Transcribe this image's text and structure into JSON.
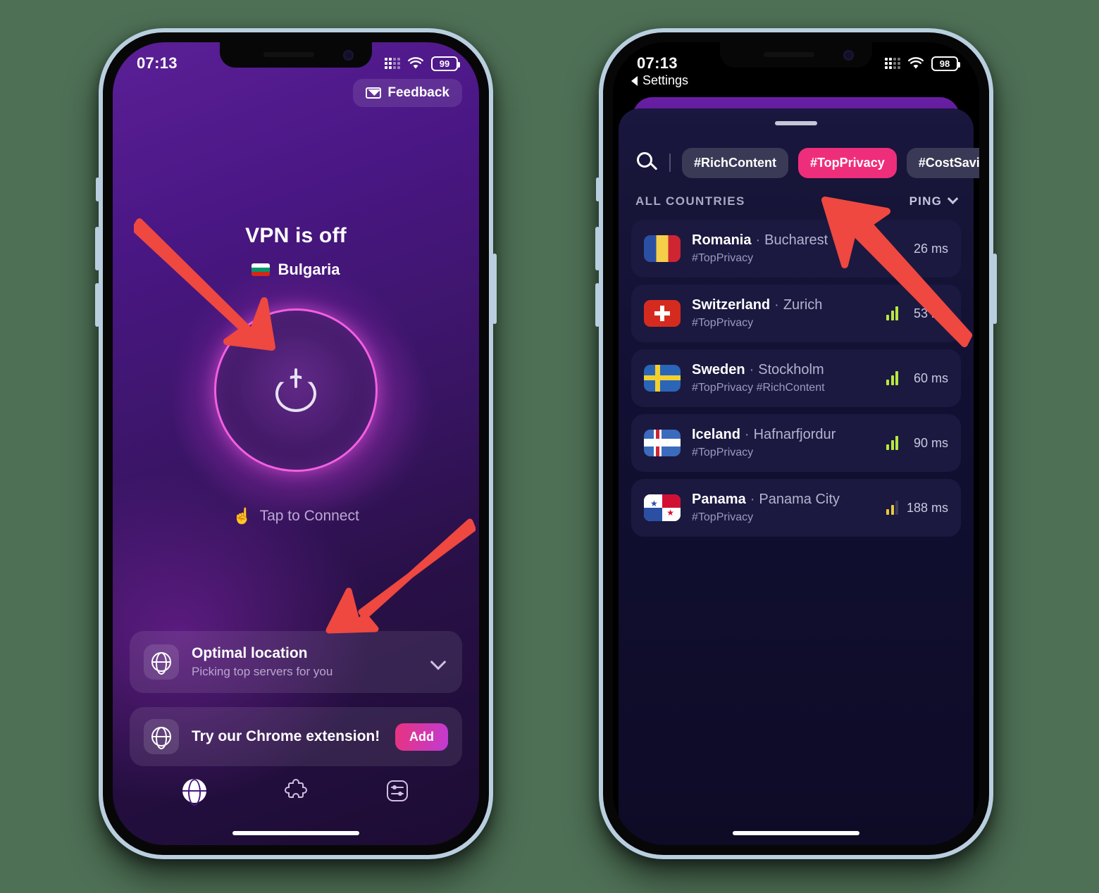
{
  "background_color": "#4e7055",
  "accent_pink": "#ef2e7b",
  "arrow_color": "#ee4840",
  "left_phone": {
    "status_bar": {
      "time": "07:13",
      "battery": "99",
      "signal_icon": "signal-dots-icon",
      "wifi_icon": "wifi-icon"
    },
    "feedback_button": {
      "label": "Feedback",
      "icon": "envelope-icon"
    },
    "vpn_status": {
      "title": "VPN is off",
      "location": "Bulgaria",
      "flag": "bulgaria-flag"
    },
    "power_button": {
      "icon": "power-icon",
      "hint": "Tap to Connect",
      "hint_icon": "tap-hand-icon"
    },
    "optimal_card": {
      "icon": "globe-icon",
      "title": "Optimal location",
      "subtitle": "Picking top servers for you",
      "chevron": "chevron-down-icon"
    },
    "chrome_card": {
      "icon": "globe-icon",
      "title": "Try our Chrome extension!",
      "button": "Add"
    },
    "tabbar": [
      {
        "name": "tab-vpn",
        "icon": "globe-solid-icon",
        "active": true
      },
      {
        "name": "tab-extensions",
        "icon": "puzzle-icon",
        "active": false
      },
      {
        "name": "tab-settings",
        "icon": "sliders-icon",
        "active": false
      }
    ]
  },
  "right_phone": {
    "status_bar": {
      "time": "07:13",
      "battery": "98",
      "signal_icon": "signal-dots-icon",
      "wifi_icon": "wifi-icon"
    },
    "back_label": "Settings",
    "search_icon": "search-icon",
    "tags": [
      {
        "label": "#RichContent",
        "active": false
      },
      {
        "label": "#TopPrivacy",
        "active": true
      },
      {
        "label": "#CostSaving",
        "active": false
      }
    ],
    "list_header": {
      "label": "ALL COUNTRIES",
      "sort": "PING",
      "sort_chevron": "chevron-down-icon"
    },
    "rows": [
      {
        "flag": "romania-flag",
        "country": "Romania",
        "city": "Bucharest",
        "tags": "#TopPrivacy",
        "ping": "26 ms",
        "bars": 0,
        "bar_color": "green"
      },
      {
        "flag": "switzerland-flag",
        "country": "Switzerland",
        "city": "Zurich",
        "tags": "#TopPrivacy",
        "ping": "53 ms",
        "bars": 3,
        "bar_color": "green"
      },
      {
        "flag": "sweden-flag",
        "country": "Sweden",
        "city": "Stockholm",
        "tags": "#TopPrivacy #RichContent",
        "ping": "60 ms",
        "bars": 3,
        "bar_color": "green"
      },
      {
        "flag": "iceland-flag",
        "country": "Iceland",
        "city": "Hafnarfjordur",
        "tags": "#TopPrivacy",
        "ping": "90 ms",
        "bars": 3,
        "bar_color": "green"
      },
      {
        "flag": "panama-flag",
        "country": "Panama",
        "city": "Panama City",
        "tags": "#TopPrivacy",
        "ping": "188 ms",
        "bars": 2,
        "bar_color": "yellow"
      }
    ]
  },
  "annotations": [
    {
      "name": "arrow-to-power-button"
    },
    {
      "name": "arrow-to-optimal-location"
    },
    {
      "name": "arrow-to-top-privacy-tag"
    }
  ]
}
